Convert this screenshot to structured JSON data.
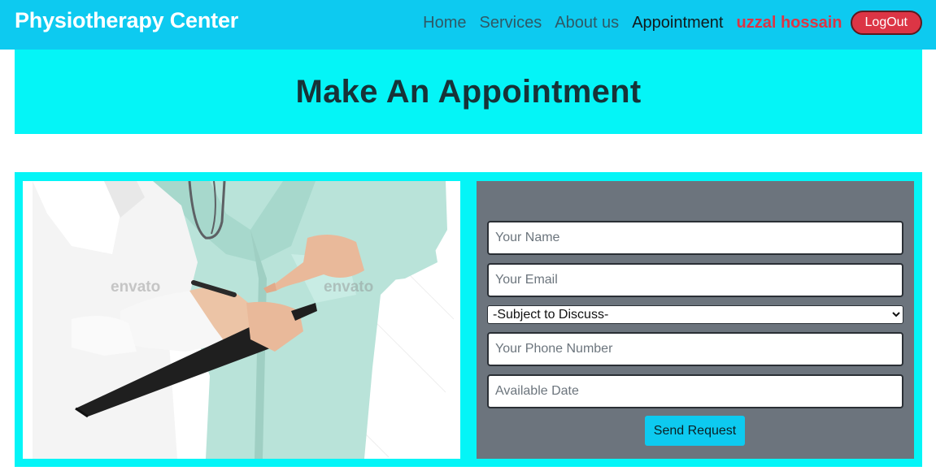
{
  "navbar": {
    "brand": "Physiotherapy Center",
    "links": [
      {
        "label": "Home"
      },
      {
        "label": "Services"
      },
      {
        "label": "About us"
      },
      {
        "label": "Appointment"
      }
    ],
    "user_name": "uzzal hossain",
    "logout_label": "LogOut"
  },
  "page": {
    "title": "Make An Appointment"
  },
  "photo": {
    "watermark_1": "envato",
    "watermark_2": "envato"
  },
  "form": {
    "name_placeholder": "Your Name",
    "email_placeholder": "Your Email",
    "subject_selected": "-Subject to Discuss-",
    "phone_placeholder": "Your Phone Number",
    "date_placeholder": "Available Date",
    "submit_label": "Send Request"
  },
  "colors": {
    "navbar": "#0dcaf0",
    "title_band": "#04f5f7",
    "form_panel": "#6c747d",
    "logout": "#dc3545"
  }
}
